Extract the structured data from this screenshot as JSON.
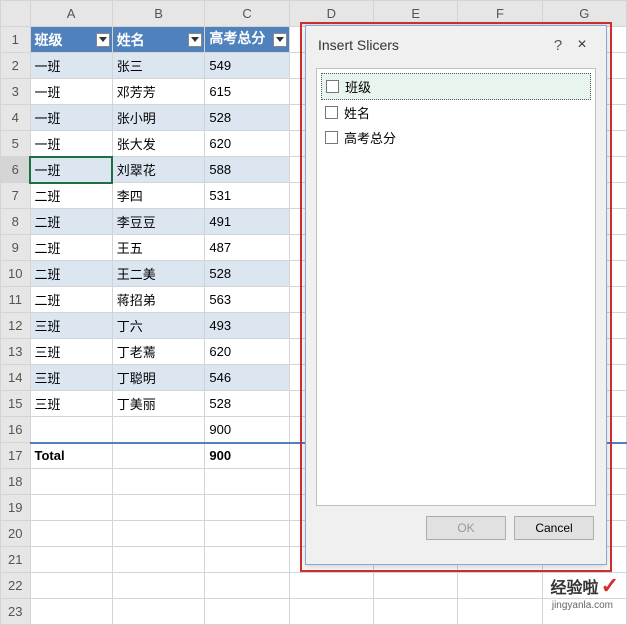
{
  "columns": [
    "A",
    "B",
    "C",
    "D",
    "E",
    "F",
    "G"
  ],
  "headers": {
    "class": "班级",
    "name": "姓名",
    "score": "高考总分"
  },
  "rows": [
    {
      "class": "一班",
      "name": "张三",
      "score": 549
    },
    {
      "class": "一班",
      "name": "邓芳芳",
      "score": 615
    },
    {
      "class": "一班",
      "name": "张小明",
      "score": 528
    },
    {
      "class": "一班",
      "name": "张大发",
      "score": 620
    },
    {
      "class": "一班",
      "name": "刘翠花",
      "score": 588
    },
    {
      "class": "二班",
      "name": "李四",
      "score": 531
    },
    {
      "class": "二班",
      "name": "李豆豆",
      "score": 491
    },
    {
      "class": "二班",
      "name": "王五",
      "score": 487
    },
    {
      "class": "二班",
      "name": "王二美",
      "score": 528
    },
    {
      "class": "二班",
      "name": "蒋招弟",
      "score": 563
    },
    {
      "class": "三班",
      "name": "丁六",
      "score": 493
    },
    {
      "class": "三班",
      "name": "丁老蔫",
      "score": 620
    },
    {
      "class": "三班",
      "name": "丁聪明",
      "score": 546
    },
    {
      "class": "三班",
      "name": "丁美丽",
      "score": 528
    }
  ],
  "subtotal": 900,
  "total": {
    "label": "Total",
    "value": 900
  },
  "visible_rows": 23,
  "selected_cell": {
    "row": 6,
    "col": "A"
  },
  "dialog": {
    "title": "Insert Slicers",
    "items": [
      {
        "label": "班级",
        "focused": true
      },
      {
        "label": "姓名",
        "focused": false
      },
      {
        "label": "高考总分",
        "focused": false
      }
    ],
    "ok": "OK",
    "cancel": "Cancel"
  },
  "watermark": {
    "brand": "经验啦",
    "site": "jingyanla.com"
  }
}
